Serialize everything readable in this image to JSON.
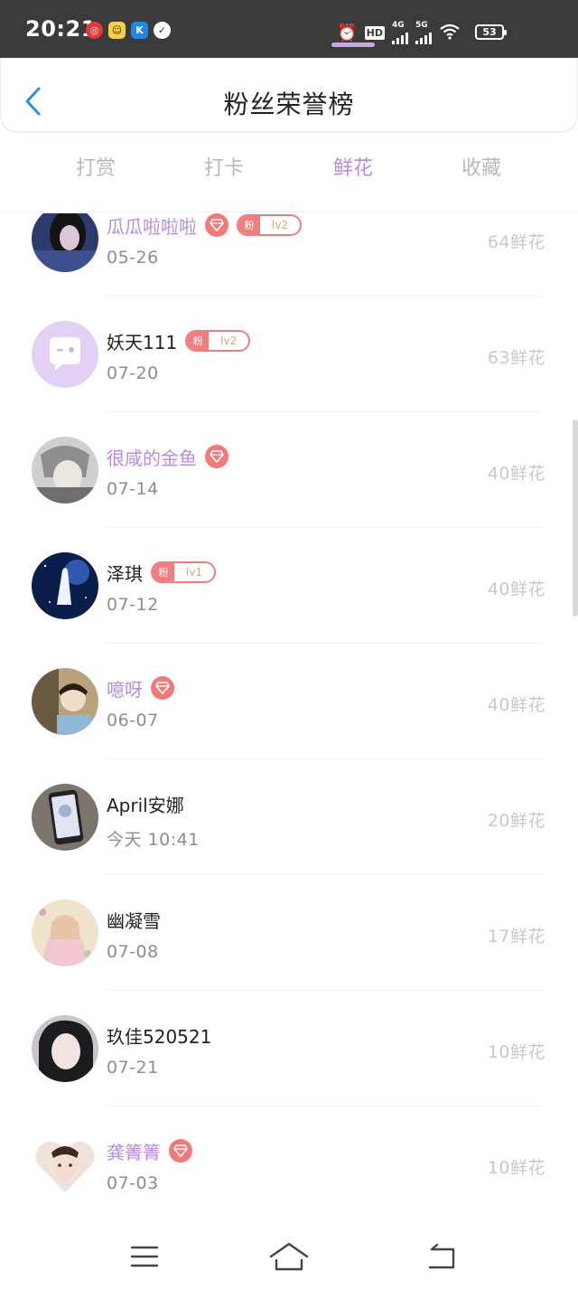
{
  "status_bar": {
    "time": "20:21",
    "notification_icons": [
      "netease-music-icon",
      "weather-icon",
      "kugou-icon",
      "messenger-icon"
    ],
    "hd_label": "HD",
    "network_4g": "4G",
    "network_5g": "5G",
    "battery": "53"
  },
  "header": {
    "title": "粉丝荣誉榜",
    "back_icon": "chevron-left-icon"
  },
  "tabs": [
    {
      "label": "打赏",
      "active": false
    },
    {
      "label": "打卡",
      "active": false
    },
    {
      "label": "鲜花",
      "active": true
    },
    {
      "label": "收藏",
      "active": false
    }
  ],
  "colors": {
    "accent": "#b98be0",
    "vip_name": "#b78ce0",
    "badge": "#ef7e7e",
    "muted": "#c8c8c8"
  },
  "fans": [
    {
      "name": "瓜瓜啦啦啦",
      "vip": true,
      "gem": true,
      "fan_badge": {
        "label": "粉",
        "level": "lv2"
      },
      "date": "05-26",
      "flowers": "64鲜花",
      "avatar": "avatar-dark-hair"
    },
    {
      "name": "妖天111",
      "vip": false,
      "gem": false,
      "fan_badge": {
        "label": "粉",
        "level": "lv2"
      },
      "date": "07-20",
      "flowers": "63鲜花",
      "avatar": "avatar-default-chat"
    },
    {
      "name": "很咸的金鱼",
      "vip": true,
      "gem": true,
      "fan_badge": null,
      "date": "07-14",
      "flowers": "40鲜花",
      "avatar": "avatar-anime"
    },
    {
      "name": "泽琪",
      "vip": false,
      "gem": false,
      "fan_badge": {
        "label": "粉",
        "level": "lv1"
      },
      "date": "07-12",
      "flowers": "40鲜花",
      "avatar": "avatar-starry-night"
    },
    {
      "name": "噫呀",
      "vip": true,
      "gem": true,
      "fan_badge": null,
      "date": "06-07",
      "flowers": "40鲜花",
      "avatar": "avatar-girl-photo"
    },
    {
      "name": "April安娜",
      "vip": false,
      "gem": false,
      "fan_badge": null,
      "date": "今天 10:41",
      "flowers": "20鲜花",
      "avatar": "avatar-phone-photo"
    },
    {
      "name": "幽凝雪",
      "vip": false,
      "gem": false,
      "fan_badge": null,
      "date": "07-08",
      "flowers": "17鲜花",
      "avatar": "avatar-illustration"
    },
    {
      "name": "玖佳520521",
      "vip": false,
      "gem": false,
      "fan_badge": null,
      "date": "07-21",
      "flowers": "10鲜花",
      "avatar": "avatar-selfie"
    },
    {
      "name": "龚箐箐",
      "vip": true,
      "gem": true,
      "fan_badge": null,
      "date": "07-03",
      "flowers": "10鲜花",
      "avatar": "avatar-heart-frame"
    }
  ],
  "nav_bar": {
    "menu_icon": "menu-icon",
    "home_icon": "home-icon",
    "back_icon": "return-icon"
  }
}
